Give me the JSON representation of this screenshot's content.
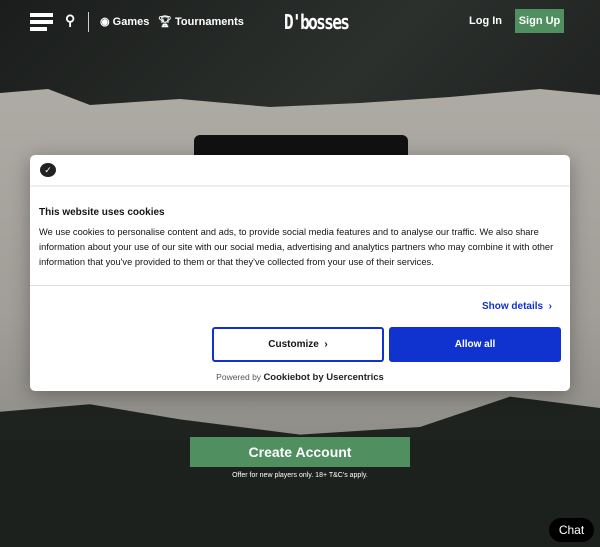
{
  "nav": {
    "games": "Games",
    "tournaments": "Tournaments",
    "logo": "D'bosses",
    "login": "Log In",
    "signup": "Sign Up"
  },
  "cookie": {
    "title": "This website uses cookies",
    "text": "We use cookies to personalise content and ads, to provide social media features and to analyse our traffic. We also share information about your use of our site with our social media, advertising and analytics partners who may combine it with other information that you've provided to them or that they've collected from your use of their services.",
    "details": "Show details",
    "customize": "Customize",
    "allow": "Allow all",
    "powered_prefix": "Powered by",
    "powered_brand": "Cookiebot by Usercentrics"
  },
  "hero": {
    "cta": "Create Account",
    "offer": "Offer for new players only. 18+ T&C's apply."
  },
  "chat": "Chat",
  "colors": {
    "green": "#4f8f60",
    "blue": "#1032cf"
  }
}
